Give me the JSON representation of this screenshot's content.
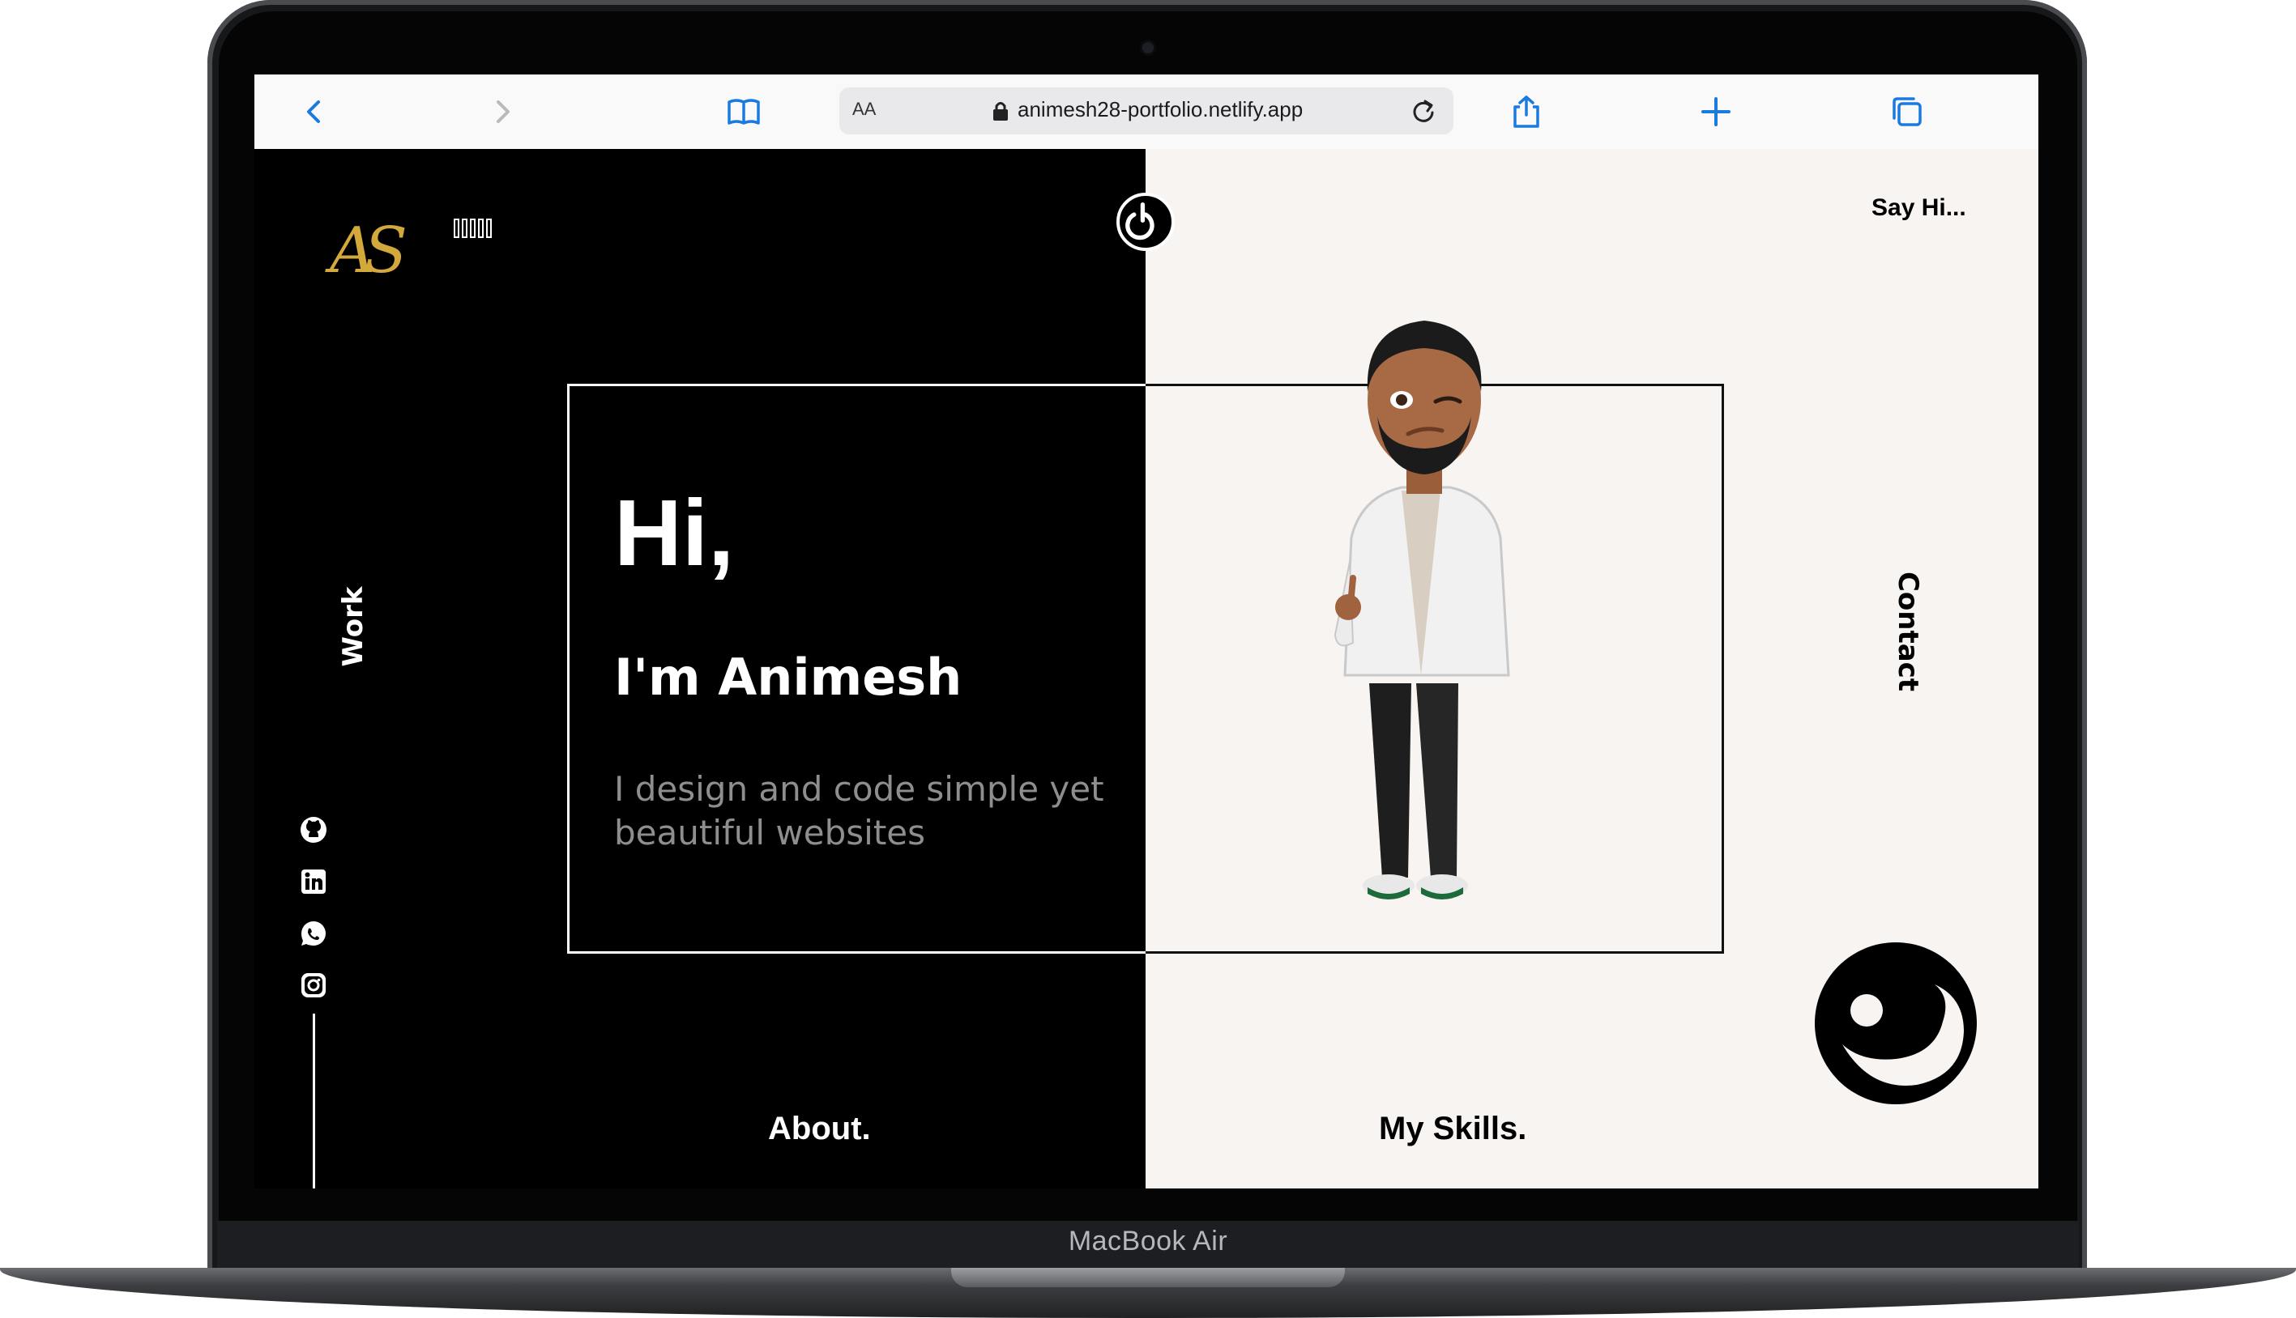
{
  "device": {
    "label": "MacBook Air"
  },
  "browser": {
    "url_text": "animesh28-portfolio.netlify.app",
    "reader_label": "AA",
    "icons": [
      "back-icon",
      "forward-icon",
      "bookmarks-icon",
      "lock-icon",
      "reload-icon",
      "share-icon",
      "new-tab-icon",
      "tabs-icon"
    ]
  },
  "site": {
    "logo_text": "AS",
    "glyph_count": 5,
    "nav": {
      "say_hi": "Say Hi...",
      "contact": "Contact",
      "work": "Work",
      "about": "About.",
      "skills": "My Skills."
    },
    "hero": {
      "greeting": "Hi,",
      "name": "I'm Animesh",
      "tagline": "I design and code simple yet beautiful websites"
    },
    "social_icons": [
      "github-icon",
      "linkedin-icon",
      "whatsapp-icon",
      "instagram-icon"
    ],
    "colors": {
      "dark_bg": "#000000",
      "light_bg": "#f7f4f1",
      "logo_gold": "#d4a93c",
      "tagline_gray": "#8e8e8e",
      "browser_accent": "#1a7ae0"
    }
  }
}
